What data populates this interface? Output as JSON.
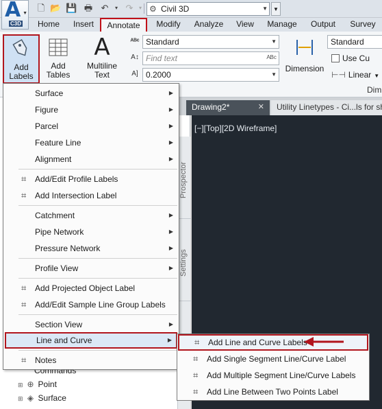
{
  "app": {
    "logo_letter": "A",
    "logo_sub": "C3D",
    "workspace": "Civil 3D",
    "accent_color": "#b1151d"
  },
  "tabs": [
    "Home",
    "Insert",
    "Annotate",
    "Modify",
    "Analyze",
    "View",
    "Manage",
    "Output",
    "Survey"
  ],
  "ribbon": {
    "add_labels": "Add Labels",
    "add_labels_line1": "Add",
    "add_labels_line2": "Labels",
    "add_tables_line1": "Add",
    "add_tables_line2": "Tables",
    "mtext_line1": "Multiline",
    "mtext_line2": "Text",
    "text_style": "Standard",
    "find_text_placeholder": "Find text",
    "text_height": "0.2000",
    "dimension": "Dimension",
    "dim_style": "Standard",
    "use_current": "Use Cu",
    "linear": "Linear",
    "panel_dim": "Dim"
  },
  "documents": {
    "tab1": "Drawing2*",
    "tab2": "Utility Linetypes - Ci...ls for sh",
    "viewport": "[−][Top][2D Wireframe]"
  },
  "side_tabs": [
    "Prospector",
    "Settings"
  ],
  "tree": {
    "commands": "Commands",
    "point": "Point",
    "surface": "Surface"
  },
  "menu": {
    "items": [
      {
        "label": "Surface",
        "submenu": true
      },
      {
        "label": "Figure",
        "submenu": true
      },
      {
        "label": "Parcel",
        "submenu": true
      },
      {
        "label": "Feature Line",
        "submenu": true
      },
      {
        "label": "Alignment",
        "submenu": true
      },
      {
        "label": "Add/Edit Profile Labels",
        "icon": "label-icon"
      },
      {
        "label": "Add Intersection Label",
        "icon": "label-icon"
      },
      {
        "label": "Catchment",
        "submenu": true
      },
      {
        "label": "Pipe Network",
        "submenu": true
      },
      {
        "label": "Pressure Network",
        "submenu": true
      },
      {
        "label": "Profile View",
        "submenu": true
      },
      {
        "label": "Add Projected Object Label",
        "icon": "label-icon"
      },
      {
        "label": "Add/Edit Sample Line Group Labels",
        "icon": "label-icon"
      },
      {
        "label": "Section View",
        "submenu": true
      },
      {
        "label": "Line and Curve",
        "submenu": true,
        "highlighted": true
      },
      {
        "label": "Notes",
        "icon": "label-icon"
      }
    ]
  },
  "submenu": {
    "items": [
      "Add Line and Curve Labels",
      "Add Single Segment Line/Curve Label",
      "Add Multiple Segment Line/Curve Labels",
      "Add Line Between Two Points Label"
    ]
  }
}
